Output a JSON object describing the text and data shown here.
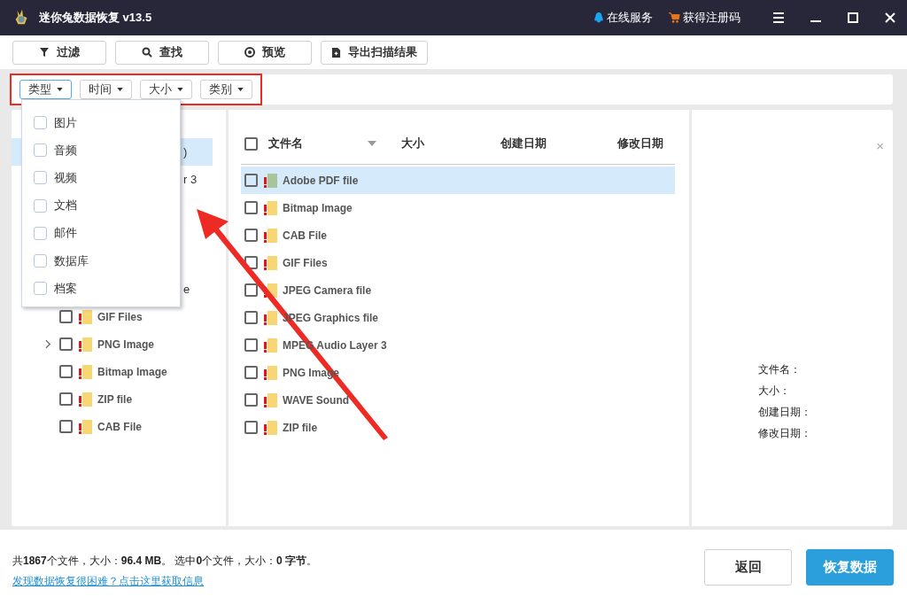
{
  "window": {
    "title": "迷你兔数据恢复 v13.5",
    "links": [
      {
        "kind": "service",
        "label": "在线服务"
      },
      {
        "kind": "cart",
        "label": "获得注册码"
      }
    ],
    "controls": [
      {
        "kind": "menu"
      },
      {
        "kind": "minimize"
      },
      {
        "kind": "maximize"
      },
      {
        "kind": "close"
      }
    ]
  },
  "toolbar": [
    {
      "kind": "filter",
      "label": "过滤"
    },
    {
      "kind": "search",
      "label": "查找"
    },
    {
      "kind": "preview",
      "label": "预览"
    },
    {
      "kind": "export",
      "label": "导出扫描结果"
    }
  ],
  "filters": [
    {
      "label": "类型",
      "open": true
    },
    {
      "label": "时间",
      "open": false
    },
    {
      "label": "大小",
      "open": false
    },
    {
      "label": "类别",
      "open": false
    }
  ],
  "type_menu": [
    {
      "label": "图片",
      "checked": false
    },
    {
      "label": "音频",
      "checked": false
    },
    {
      "label": "视频",
      "checked": false
    },
    {
      "label": "文档",
      "checked": false
    },
    {
      "label": "邮件",
      "checked": false
    },
    {
      "label": "数据库",
      "checked": false
    },
    {
      "label": "档案",
      "checked": false
    }
  ],
  "tree": [
    {
      "kind": "covered",
      "tail": ")",
      "selected": true
    },
    {
      "kind": "covered",
      "tail": "r 3",
      "selected": false
    },
    {
      "kind": "covered",
      "selected": false
    },
    {
      "kind": "covered",
      "selected": false
    },
    {
      "kind": "covered",
      "selected": false
    },
    {
      "kind": "covered",
      "tail": "e",
      "selected": false
    },
    {
      "kind": "item",
      "label": "GIF Files",
      "expandable": false,
      "selected": false
    },
    {
      "kind": "item",
      "label": "PNG Image",
      "expandable": true,
      "selected": false
    },
    {
      "kind": "item",
      "label": "Bitmap Image",
      "expandable": false,
      "selected": false
    },
    {
      "kind": "item",
      "label": "ZIP file",
      "expandable": false,
      "selected": false
    },
    {
      "kind": "item",
      "label": "CAB File",
      "expandable": false,
      "selected": false
    }
  ],
  "file_list": {
    "select_all_checked": false,
    "columns": [
      {
        "label": "文件名",
        "sortable": true
      },
      {
        "label": "大小",
        "sortable": false
      },
      {
        "label": "创建日期",
        "sortable": false
      },
      {
        "label": "修改日期",
        "sortable": false
      }
    ],
    "rows": [
      {
        "name": "Adobe PDF file",
        "selected": true,
        "color": "#a8c49a"
      },
      {
        "name": "Bitmap Image",
        "selected": false,
        "color": "#f7d774"
      },
      {
        "name": "CAB File",
        "selected": false,
        "color": "#f7d774"
      },
      {
        "name": "GIF Files",
        "selected": false,
        "color": "#f7d774"
      },
      {
        "name": "JPEG Camera file",
        "selected": false,
        "color": "#f7d774"
      },
      {
        "name": "JPEG Graphics file",
        "selected": false,
        "color": "#f7d774"
      },
      {
        "name": "MPEG Audio Layer 3",
        "selected": false,
        "color": "#f7d774"
      },
      {
        "name": "PNG Image",
        "selected": false,
        "color": "#f7d774"
      },
      {
        "name": "WAVE Sound",
        "selected": false,
        "color": "#f7d774"
      },
      {
        "name": "ZIP file",
        "selected": false,
        "color": "#f7d774"
      }
    ]
  },
  "detail": {
    "close": "×",
    "fields": [
      "文件名：",
      "大小：",
      "创建日期：",
      "修改日期："
    ]
  },
  "status": {
    "summary": "共**1867**个文件，大小：**96.4 MB**。 选中**0**个文件，大小：**0 字节**。",
    "help_link": "发现数据恢复很困难？点击这里获取信息",
    "buttons": [
      {
        "kind": "secondary",
        "label": "返回"
      },
      {
        "kind": "primary",
        "label": "恢复数据"
      }
    ]
  }
}
